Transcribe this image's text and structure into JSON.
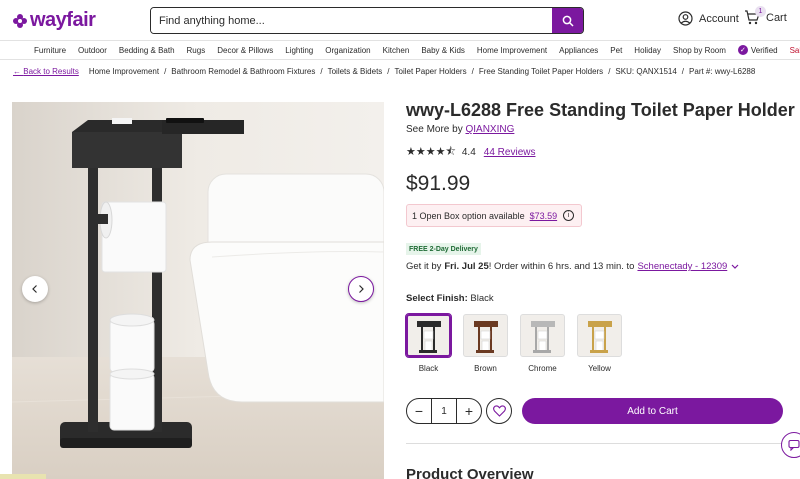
{
  "header": {
    "logo_text": "wayfair",
    "search_placeholder": "Find anything home...",
    "account_label": "Account",
    "cart_label": "Cart",
    "cart_count": "1"
  },
  "nav": {
    "items": [
      "Furniture",
      "Outdoor",
      "Bedding & Bath",
      "Rugs",
      "Decor & Pillows",
      "Lighting",
      "Organization",
      "Kitchen",
      "Baby & Kids",
      "Home Improvement",
      "Appliances",
      "Pet",
      "Holiday",
      "Shop by Room"
    ],
    "verified_label": "Verified",
    "sale_label": "Sale"
  },
  "breadcrumb": {
    "back_label": "Back to Results",
    "items": [
      "Home Improvement",
      "Bathroom Remodel & Bathroom Fixtures",
      "Toilets & Bidets",
      "Toilet Paper Holders",
      "Free Standing Toilet Paper Holders"
    ],
    "sku": "SKU: QANX1514",
    "part": "Part #: wwy-L6288"
  },
  "product": {
    "title": "wwy-L6288 Free Standing Toilet Paper Holder",
    "see_more_prefix": "See More by",
    "brand": "QIANXING",
    "rating": "4.4",
    "stars_value": 4.4,
    "reviews_label": "44 Reviews",
    "price": "$91.99",
    "open_box_text": "1 Open Box option available",
    "open_box_price": "$73.59",
    "delivery_badge": "FREE 2-Day Delivery",
    "get_it_prefix": "Get it by",
    "get_it_date": "Fri. Jul 25",
    "get_it_suffix": "! Order within 6 hrs. and 13 min. to",
    "location": "Schenectady - 12309",
    "select_finish_label": "Select Finish:",
    "selected_finish": "Black",
    "finishes": [
      "Black",
      "Brown",
      "Chrome",
      "Yellow"
    ],
    "quantity": "1",
    "add_to_cart_label": "Add to Cart",
    "overview_heading": "Product Overview"
  },
  "colors": {
    "brand_purple": "#7b189f",
    "sale_red": "#c0112f"
  }
}
